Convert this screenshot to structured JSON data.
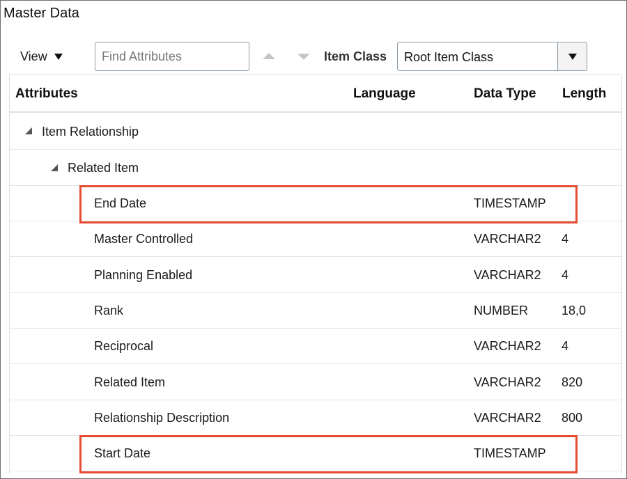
{
  "header": {
    "title": "Master Data"
  },
  "toolbar": {
    "view_label": "View",
    "find_placeholder": "Find Attributes",
    "find_value": "",
    "item_class_label": "Item Class",
    "item_class_value": "Root Item Class"
  },
  "table": {
    "columns": [
      "Attributes",
      "Language",
      "Data Type",
      "Length"
    ],
    "groups": [
      {
        "label": "Item Relationship"
      },
      {
        "label": "Related Item"
      }
    ],
    "rows": [
      {
        "attribute": "End Date",
        "language": "",
        "data_type": "TIMESTAMP",
        "length": "",
        "highlighted": true
      },
      {
        "attribute": "Master Controlled",
        "language": "",
        "data_type": "VARCHAR2",
        "length": "4",
        "highlighted": false
      },
      {
        "attribute": "Planning Enabled",
        "language": "",
        "data_type": "VARCHAR2",
        "length": "4",
        "highlighted": false
      },
      {
        "attribute": "Rank",
        "language": "",
        "data_type": "NUMBER",
        "length": "18,0",
        "highlighted": false
      },
      {
        "attribute": "Reciprocal",
        "language": "",
        "data_type": "VARCHAR2",
        "length": "4",
        "highlighted": false
      },
      {
        "attribute": "Related Item",
        "language": "",
        "data_type": "VARCHAR2",
        "length": "820",
        "highlighted": false
      },
      {
        "attribute": "Relationship Description",
        "language": "",
        "data_type": "VARCHAR2",
        "length": "800",
        "highlighted": false
      },
      {
        "attribute": "Start Date",
        "language": "",
        "data_type": "TIMESTAMP",
        "length": "",
        "highlighted": true
      }
    ]
  },
  "colors": {
    "highlight": "#e64b33",
    "border": "#8a9aa8"
  }
}
